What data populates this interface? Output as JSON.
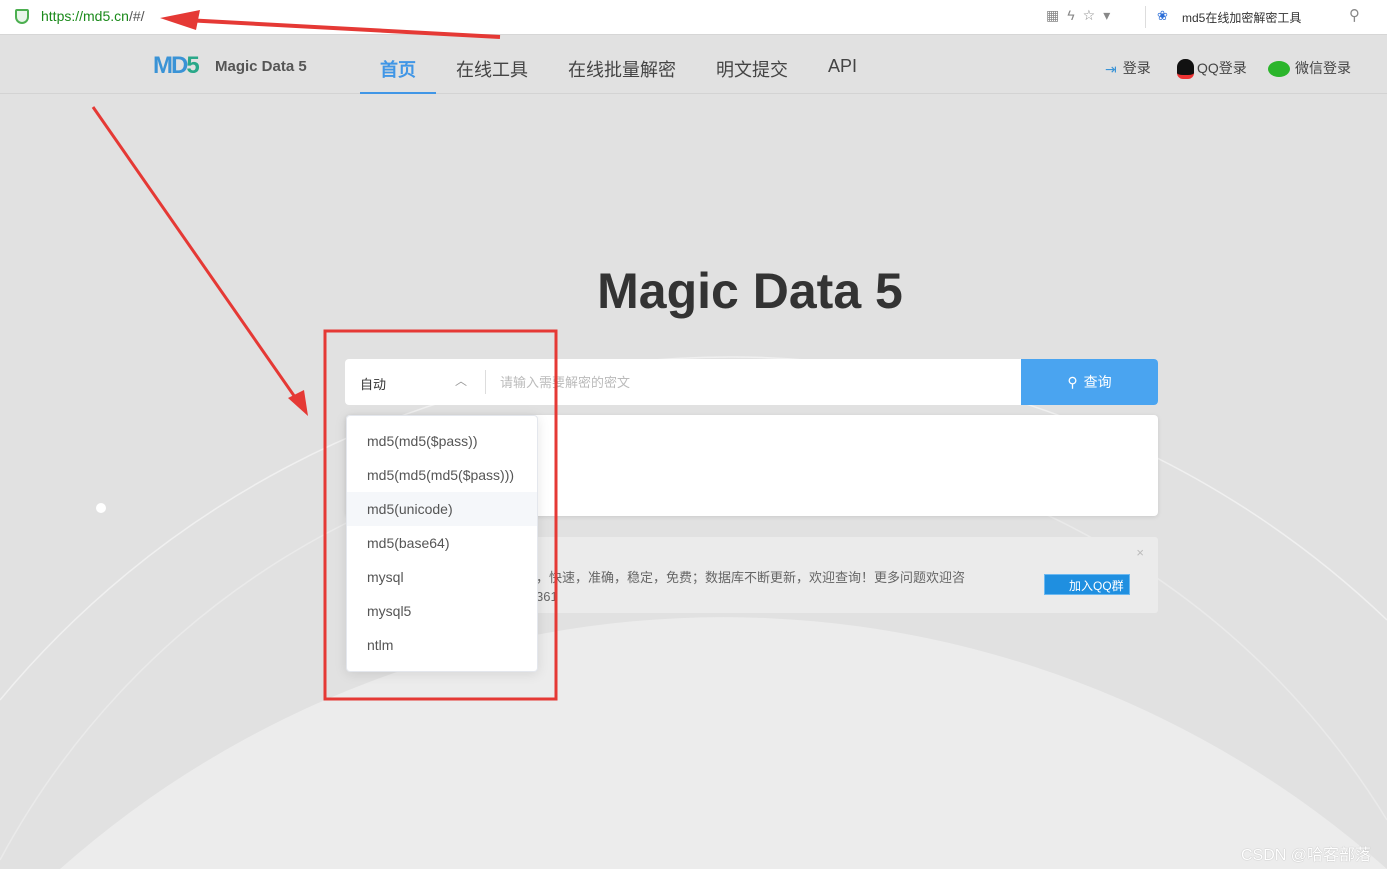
{
  "browser": {
    "url_main": "https://md5.cn",
    "url_tail": "/#/",
    "tab_title": "md5在线加密解密工具",
    "icons": [
      "qr-icon",
      "lightning-icon",
      "star-icon",
      "dropdown-icon"
    ]
  },
  "nav": {
    "logo_text": "Magic Data 5",
    "logo_letters": [
      "M",
      "D",
      "5"
    ],
    "items": [
      "首页",
      "在线工具",
      "在线批量解密",
      "明文提交",
      "API"
    ],
    "active": 0,
    "login": "登录",
    "qq_login": "QQ登录",
    "wechat_login": "微信登录"
  },
  "hero": {
    "title": "Magic Data 5"
  },
  "search": {
    "type_selected": "自动",
    "placeholder": "请输入需要解密的密文",
    "button": "查询"
  },
  "dropdown": {
    "options": [
      "md5(md5($pass))",
      "md5(md5(md5($pass)))",
      "md5(unicode)",
      "md5(base64)",
      "mysql",
      "mysql5",
      "ntlm"
    ],
    "hovered": 2
  },
  "notice": {
    "line1": "，快速，准确，稳定，免费；数据库不断更新，欢迎查询！更多问题欢迎咨",
    "line2": "361",
    "join_qq": "加入QQ群",
    "close": "×"
  },
  "watermark": "CSDN @哈客部落",
  "colors": {
    "accent": "#4096e6",
    "button": "#4aa4f0",
    "annotation": "#e53935"
  }
}
